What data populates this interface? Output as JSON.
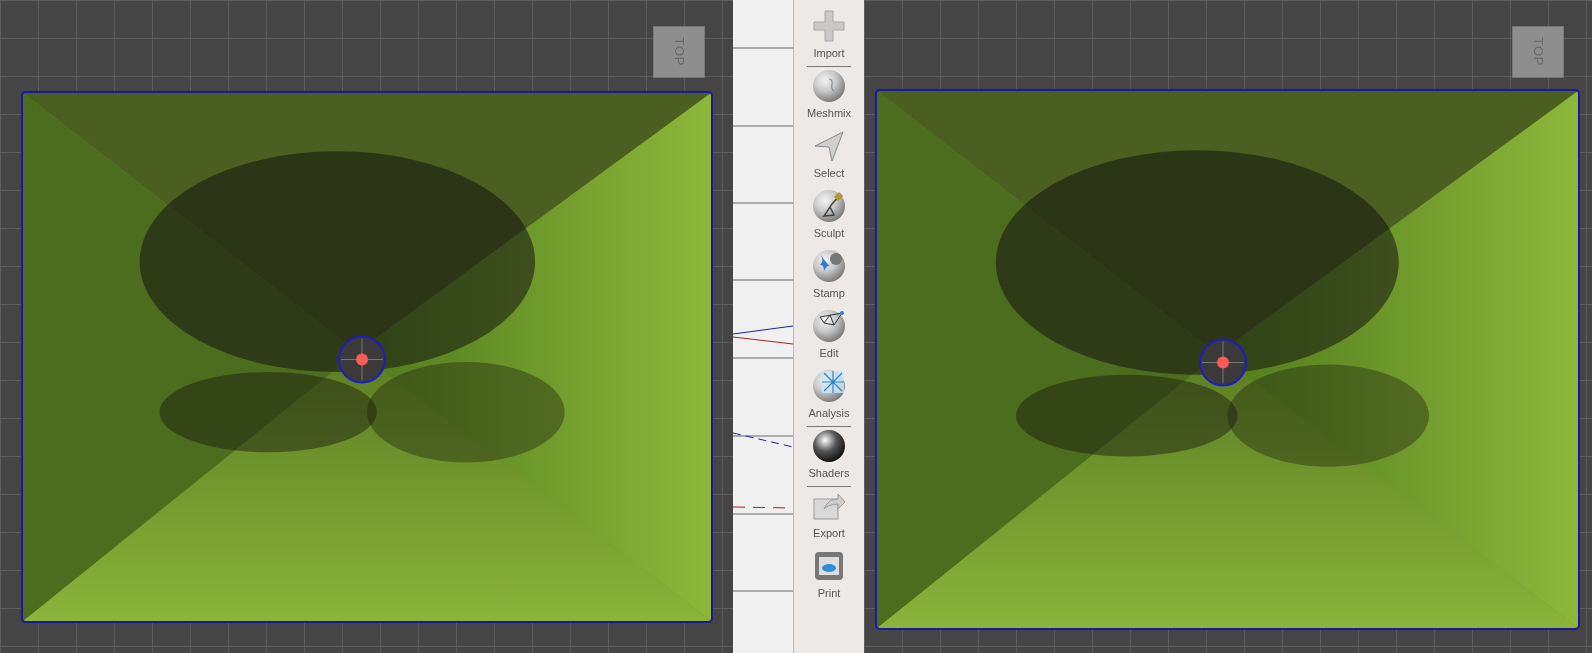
{
  "viewports": [
    {
      "view_cube": "TOP"
    },
    {
      "view_cube": "TOP"
    }
  ],
  "toolbar": [
    {
      "kind": "import",
      "label": "Import",
      "separator_after": true
    },
    {
      "kind": "meshmix",
      "label": "Meshmix",
      "separator_after": false
    },
    {
      "kind": "select",
      "label": "Select",
      "separator_after": false
    },
    {
      "kind": "sculpt",
      "label": "Sculpt",
      "separator_after": false
    },
    {
      "kind": "stamp",
      "label": "Stamp",
      "separator_after": false
    },
    {
      "kind": "edit",
      "label": "Edit",
      "separator_after": false
    },
    {
      "kind": "analysis",
      "label": "Analysis",
      "separator_after": true
    },
    {
      "kind": "shaders",
      "label": "Shaders",
      "separator_after": true
    },
    {
      "kind": "export",
      "label": "Export",
      "separator_after": false
    },
    {
      "kind": "print",
      "label": "Print",
      "separator_after": false
    }
  ]
}
